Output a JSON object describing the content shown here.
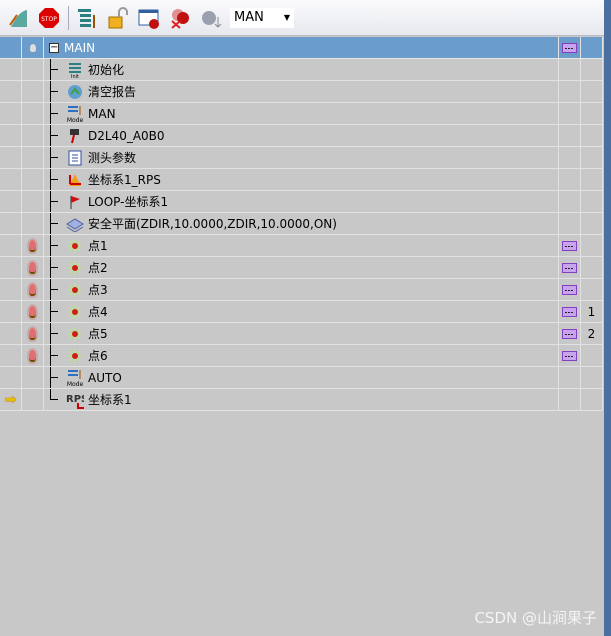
{
  "toolbar": {
    "buttons": [
      "edit-curve-icon",
      "stop-icon",
      "sort-icon",
      "unlock-icon",
      "window-record-icon",
      "delete-points-icon",
      "ball-down-icon"
    ],
    "mode_select": "MAN"
  },
  "tree": {
    "root": "MAIN",
    "rows": [
      {
        "label": "初始化",
        "icon": "init-icon",
        "bulb": false,
        "table": false,
        "num": ""
      },
      {
        "label": "清空报告",
        "icon": "clear-report-icon",
        "bulb": false,
        "table": false,
        "num": ""
      },
      {
        "label": "MAN",
        "icon": "mode-icon",
        "bulb": false,
        "table": false,
        "num": ""
      },
      {
        "label": "D2L40_A0B0",
        "icon": "probe-icon",
        "bulb": false,
        "table": false,
        "num": ""
      },
      {
        "label": "测头参数",
        "icon": "probe-params-icon",
        "bulb": false,
        "table": false,
        "num": ""
      },
      {
        "label": "坐标系1_RPS",
        "icon": "coordinate-system-icon",
        "bulb": false,
        "table": false,
        "num": ""
      },
      {
        "label": "LOOP-坐标系1",
        "icon": "loop-flag-icon",
        "bulb": false,
        "table": false,
        "num": ""
      },
      {
        "label": "安全平面(ZDIR,10.0000,ZDIR,10.0000,ON)",
        "icon": "safety-plane-icon",
        "bulb": false,
        "table": false,
        "num": ""
      },
      {
        "label": "点1",
        "icon": "point-icon",
        "bulb": true,
        "table": true,
        "num": ""
      },
      {
        "label": "点2",
        "icon": "point-icon",
        "bulb": true,
        "table": true,
        "num": ""
      },
      {
        "label": "点3",
        "icon": "point-icon",
        "bulb": true,
        "table": true,
        "num": ""
      },
      {
        "label": "点4",
        "icon": "point-icon",
        "bulb": true,
        "table": true,
        "num": "1"
      },
      {
        "label": "点5",
        "icon": "point-icon",
        "bulb": true,
        "table": true,
        "num": "2"
      },
      {
        "label": "点6",
        "icon": "point-icon",
        "bulb": true,
        "table": true,
        "num": ""
      },
      {
        "label": "AUTO",
        "icon": "mode-icon",
        "bulb": false,
        "table": false,
        "num": ""
      },
      {
        "label": "坐标系1",
        "icon": "rps-icon",
        "bulb": false,
        "table": false,
        "num": "",
        "current": true
      }
    ]
  },
  "watermark": "CSDN @山涧果子"
}
